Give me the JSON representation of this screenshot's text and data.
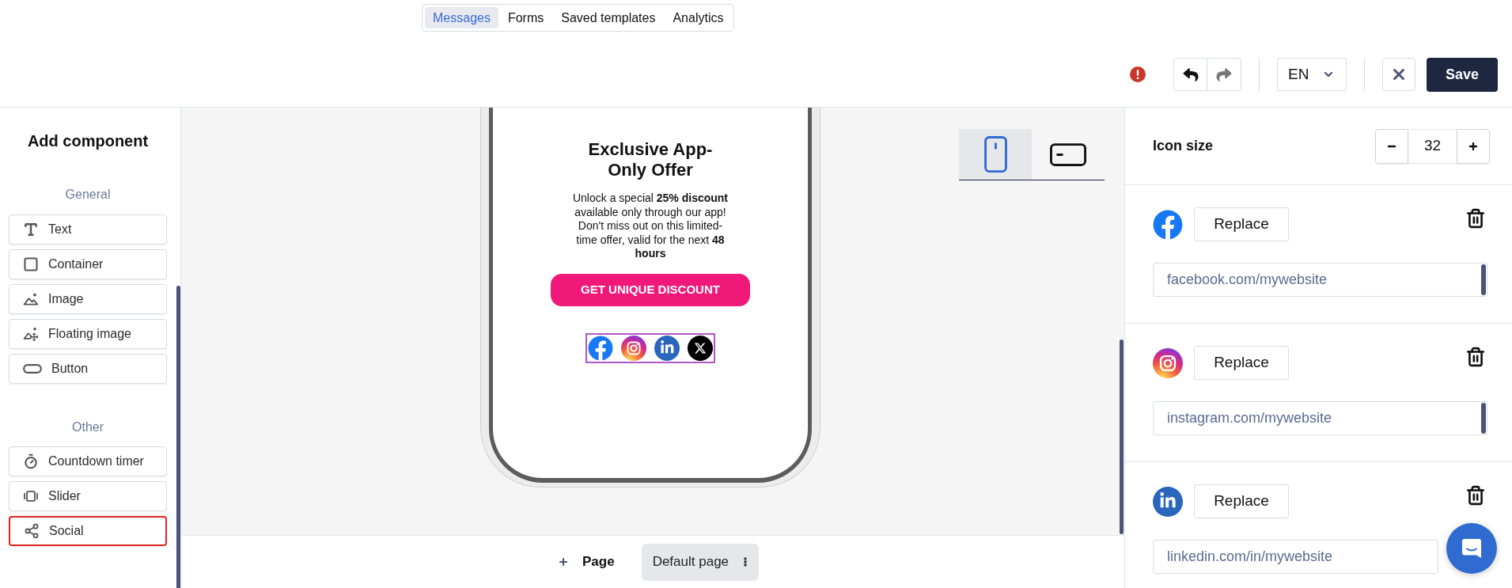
{
  "top_tabs": [
    {
      "label": "Messages",
      "selected": true
    },
    {
      "label": "Forms",
      "selected": false
    },
    {
      "label": "Saved templates",
      "selected": false
    },
    {
      "label": "Analytics",
      "selected": false
    }
  ],
  "toolbar": {
    "undo": {
      "disabled": false
    },
    "redo": {
      "disabled": true
    },
    "language": "EN",
    "save": "Save"
  },
  "sidebar": {
    "title": "Add component",
    "groups": [
      {
        "label": "General",
        "items": [
          {
            "kind": "text",
            "label": "Text",
            "selected": false
          },
          {
            "kind": "container",
            "label": "Container",
            "selected": false
          },
          {
            "kind": "image",
            "label": "Image",
            "selected": false
          },
          {
            "kind": "floating_image",
            "label": "Floating image",
            "selected": false
          },
          {
            "kind": "button",
            "label": "Button",
            "selected": false
          }
        ]
      },
      {
        "label": "Other",
        "items": [
          {
            "kind": "countdown_timer",
            "label": "Countdown timer",
            "selected": false
          },
          {
            "kind": "slider",
            "label": "Slider",
            "selected": false
          },
          {
            "kind": "social",
            "label": "Social",
            "selected": true
          }
        ]
      }
    ]
  },
  "canvas": {
    "device_toggle": [
      {
        "kind": "mobile",
        "selected": true
      },
      {
        "kind": "tablet",
        "selected": false
      }
    ],
    "phone": {
      "heading": "Exclusive App-Only Offer",
      "body": "Unlock a special **25% discount** available only through our app! Don't miss out on this limited-time offer, valid for the next **48 hours**",
      "cta": "GET UNIQUE DISCOUNT",
      "social_block": {
        "selected": true,
        "icons": [
          {
            "kind": "facebook"
          },
          {
            "kind": "instagram"
          },
          {
            "kind": "linkedin"
          },
          {
            "kind": "x"
          }
        ]
      }
    }
  },
  "page_bar": {
    "add_page": "Page",
    "pages": [
      {
        "label": "Default page",
        "selected": true
      }
    ]
  },
  "settings": {
    "icon_size": {
      "label": "Icon size",
      "value": "32"
    },
    "networks": [
      {
        "kind": "facebook",
        "button": "Replace",
        "url": "facebook.com/mywebsite"
      },
      {
        "kind": "instagram",
        "button": "Replace",
        "url": "instagram.com/mywebsite"
      },
      {
        "kind": "linkedin",
        "button": "Replace",
        "url": "linkedin.com/in/mywebsite"
      }
    ]
  }
}
